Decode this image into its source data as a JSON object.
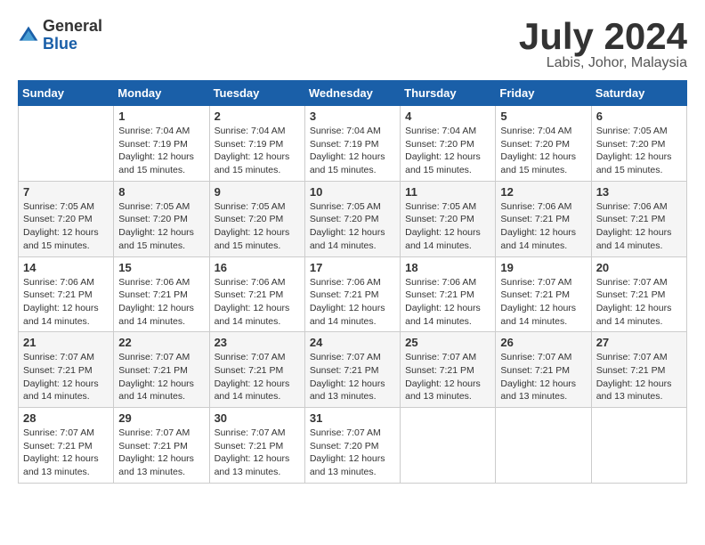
{
  "header": {
    "logo_general": "General",
    "logo_blue": "Blue",
    "month_title": "July 2024",
    "location": "Labis, Johor, Malaysia"
  },
  "days_of_week": [
    "Sunday",
    "Monday",
    "Tuesday",
    "Wednesday",
    "Thursday",
    "Friday",
    "Saturday"
  ],
  "weeks": [
    [
      {
        "day": "",
        "info": ""
      },
      {
        "day": "1",
        "info": "Sunrise: 7:04 AM\nSunset: 7:19 PM\nDaylight: 12 hours\nand 15 minutes."
      },
      {
        "day": "2",
        "info": "Sunrise: 7:04 AM\nSunset: 7:19 PM\nDaylight: 12 hours\nand 15 minutes."
      },
      {
        "day": "3",
        "info": "Sunrise: 7:04 AM\nSunset: 7:19 PM\nDaylight: 12 hours\nand 15 minutes."
      },
      {
        "day": "4",
        "info": "Sunrise: 7:04 AM\nSunset: 7:20 PM\nDaylight: 12 hours\nand 15 minutes."
      },
      {
        "day": "5",
        "info": "Sunrise: 7:04 AM\nSunset: 7:20 PM\nDaylight: 12 hours\nand 15 minutes."
      },
      {
        "day": "6",
        "info": "Sunrise: 7:05 AM\nSunset: 7:20 PM\nDaylight: 12 hours\nand 15 minutes."
      }
    ],
    [
      {
        "day": "7",
        "info": "Sunrise: 7:05 AM\nSunset: 7:20 PM\nDaylight: 12 hours\nand 15 minutes."
      },
      {
        "day": "8",
        "info": "Sunrise: 7:05 AM\nSunset: 7:20 PM\nDaylight: 12 hours\nand 15 minutes."
      },
      {
        "day": "9",
        "info": "Sunrise: 7:05 AM\nSunset: 7:20 PM\nDaylight: 12 hours\nand 15 minutes."
      },
      {
        "day": "10",
        "info": "Sunrise: 7:05 AM\nSunset: 7:20 PM\nDaylight: 12 hours\nand 14 minutes."
      },
      {
        "day": "11",
        "info": "Sunrise: 7:05 AM\nSunset: 7:20 PM\nDaylight: 12 hours\nand 14 minutes."
      },
      {
        "day": "12",
        "info": "Sunrise: 7:06 AM\nSunset: 7:21 PM\nDaylight: 12 hours\nand 14 minutes."
      },
      {
        "day": "13",
        "info": "Sunrise: 7:06 AM\nSunset: 7:21 PM\nDaylight: 12 hours\nand 14 minutes."
      }
    ],
    [
      {
        "day": "14",
        "info": "Sunrise: 7:06 AM\nSunset: 7:21 PM\nDaylight: 12 hours\nand 14 minutes."
      },
      {
        "day": "15",
        "info": "Sunrise: 7:06 AM\nSunset: 7:21 PM\nDaylight: 12 hours\nand 14 minutes."
      },
      {
        "day": "16",
        "info": "Sunrise: 7:06 AM\nSunset: 7:21 PM\nDaylight: 12 hours\nand 14 minutes."
      },
      {
        "day": "17",
        "info": "Sunrise: 7:06 AM\nSunset: 7:21 PM\nDaylight: 12 hours\nand 14 minutes."
      },
      {
        "day": "18",
        "info": "Sunrise: 7:06 AM\nSunset: 7:21 PM\nDaylight: 12 hours\nand 14 minutes."
      },
      {
        "day": "19",
        "info": "Sunrise: 7:07 AM\nSunset: 7:21 PM\nDaylight: 12 hours\nand 14 minutes."
      },
      {
        "day": "20",
        "info": "Sunrise: 7:07 AM\nSunset: 7:21 PM\nDaylight: 12 hours\nand 14 minutes."
      }
    ],
    [
      {
        "day": "21",
        "info": "Sunrise: 7:07 AM\nSunset: 7:21 PM\nDaylight: 12 hours\nand 14 minutes."
      },
      {
        "day": "22",
        "info": "Sunrise: 7:07 AM\nSunset: 7:21 PM\nDaylight: 12 hours\nand 14 minutes."
      },
      {
        "day": "23",
        "info": "Sunrise: 7:07 AM\nSunset: 7:21 PM\nDaylight: 12 hours\nand 14 minutes."
      },
      {
        "day": "24",
        "info": "Sunrise: 7:07 AM\nSunset: 7:21 PM\nDaylight: 12 hours\nand 13 minutes."
      },
      {
        "day": "25",
        "info": "Sunrise: 7:07 AM\nSunset: 7:21 PM\nDaylight: 12 hours\nand 13 minutes."
      },
      {
        "day": "26",
        "info": "Sunrise: 7:07 AM\nSunset: 7:21 PM\nDaylight: 12 hours\nand 13 minutes."
      },
      {
        "day": "27",
        "info": "Sunrise: 7:07 AM\nSunset: 7:21 PM\nDaylight: 12 hours\nand 13 minutes."
      }
    ],
    [
      {
        "day": "28",
        "info": "Sunrise: 7:07 AM\nSunset: 7:21 PM\nDaylight: 12 hours\nand 13 minutes."
      },
      {
        "day": "29",
        "info": "Sunrise: 7:07 AM\nSunset: 7:21 PM\nDaylight: 12 hours\nand 13 minutes."
      },
      {
        "day": "30",
        "info": "Sunrise: 7:07 AM\nSunset: 7:21 PM\nDaylight: 12 hours\nand 13 minutes."
      },
      {
        "day": "31",
        "info": "Sunrise: 7:07 AM\nSunset: 7:20 PM\nDaylight: 12 hours\nand 13 minutes."
      },
      {
        "day": "",
        "info": ""
      },
      {
        "day": "",
        "info": ""
      },
      {
        "day": "",
        "info": ""
      }
    ]
  ]
}
